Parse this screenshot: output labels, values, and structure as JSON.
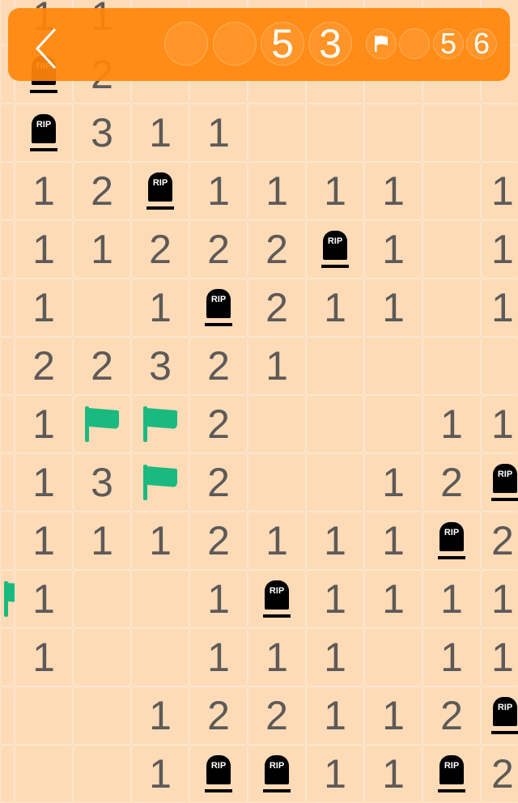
{
  "header": {
    "back_icon": "chevron-left-icon",
    "timer_digits": [
      "",
      "",
      "5",
      "3"
    ],
    "mine_counter_icon": "flag-icon",
    "mine_digits": [
      "",
      "5",
      "6"
    ]
  },
  "colors": {
    "header": "#ff850a",
    "board": "#fedcb9",
    "flag": "#1ab97f",
    "number": "#5d5a58"
  },
  "board": {
    "legend": {
      "R": "RIP tombstone (mine)",
      "F": "flag"
    },
    "tombstone_text": "RIP",
    "rows": [
      [
        "",
        "1",
        "1",
        "",
        "",
        "",
        "",
        "",
        "",
        ""
      ],
      [
        "",
        "R",
        "2",
        "",
        "",
        "",
        "",
        "",
        "",
        ""
      ],
      [
        "",
        "R",
        "3",
        "1",
        "1",
        "",
        "",
        "",
        "",
        ""
      ],
      [
        "",
        "1",
        "2",
        "R",
        "1",
        "1",
        "1",
        "1",
        "",
        "1"
      ],
      [
        "",
        "1",
        "1",
        "2",
        "2",
        "2",
        "R",
        "1",
        "",
        "1"
      ],
      [
        "",
        "1",
        "",
        "1",
        "R",
        "2",
        "1",
        "1",
        "",
        "1"
      ],
      [
        "",
        "2",
        "2",
        "3",
        "2",
        "1",
        "",
        "",
        "",
        ""
      ],
      [
        "",
        "1",
        "F",
        "F",
        "2",
        "",
        "",
        "",
        "1",
        "1"
      ],
      [
        "",
        "1",
        "3",
        "F",
        "2",
        "",
        "",
        "1",
        "2",
        "R"
      ],
      [
        "",
        "1",
        "1",
        "1",
        "2",
        "1",
        "1",
        "1",
        "R",
        "2"
      ],
      [
        "F",
        "1",
        "",
        "",
        "1",
        "R",
        "1",
        "1",
        "1",
        "1"
      ],
      [
        "",
        "1",
        "",
        "",
        "1",
        "1",
        "1",
        "",
        "1",
        "1"
      ],
      [
        "",
        "",
        "",
        "1",
        "2",
        "2",
        "1",
        "1",
        "2",
        "R"
      ],
      [
        "",
        "",
        "",
        "1",
        "R",
        "R",
        "1",
        "1",
        "R",
        "2"
      ]
    ]
  }
}
